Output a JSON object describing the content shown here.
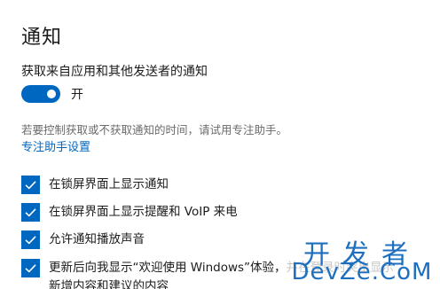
{
  "page": {
    "title": "通知"
  },
  "section": {
    "label": "获取来自应用和其他发送者的通知"
  },
  "toggle": {
    "state_label": "开",
    "on": true,
    "color": "#0067c0"
  },
  "hint": {
    "text": "若要控制获取或不获取通知的时间，请试用专注助手。"
  },
  "link": {
    "text": "专注助手设置",
    "color": "#0067c0"
  },
  "options": [
    {
      "label": "在锁屏界面上显示通知",
      "checked": true
    },
    {
      "label": "在锁屏界面上显示提醒和 VoIP 来电",
      "checked": true
    },
    {
      "label": "允许通知播放声音",
      "checked": true
    },
    {
      "label": "更新后向我显示“欢迎使用 Windows”体验，并在登录时突出显示",
      "label_line2": "新增内容和建议的内容",
      "checked": true
    }
  ],
  "watermark": {
    "top": "开发者",
    "bottom": "DevZe.CoM"
  }
}
